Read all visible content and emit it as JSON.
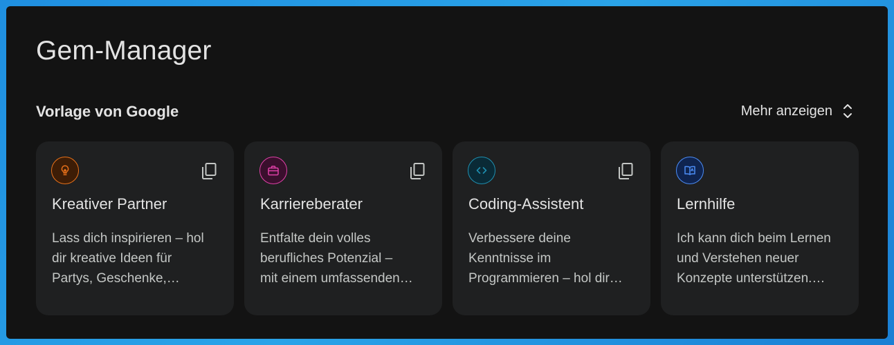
{
  "page": {
    "title": "Gem-Manager"
  },
  "section": {
    "title": "Vorlage von Google",
    "more_label": "Mehr anzeigen"
  },
  "cards": [
    {
      "title": "Kreativer Partner",
      "icon": "lightbulb-icon",
      "accent": "#e8711a",
      "icon_bg": "#3d1d06",
      "desc_lines": [
        "Lass dich inspirieren – hol",
        "dir kreative Ideen für",
        "Partys, Geschenke,…"
      ]
    },
    {
      "title": "Karriereberater",
      "icon": "briefcase-icon",
      "accent": "#e040a8",
      "icon_bg": "#3a0f2d",
      "desc_lines": [
        "Entfalte dein volles",
        "berufliches Potenzial –",
        "mit einem umfassenden…"
      ]
    },
    {
      "title": "Coding-Assistent",
      "icon": "code-icon",
      "accent": "#1e8fb0",
      "icon_bg": "#0a2a36",
      "desc_lines": [
        "Verbessere deine",
        "Kenntnisse im",
        "Programmieren – hol dir…"
      ]
    },
    {
      "title": "Lernhilfe",
      "icon": "book-icon",
      "accent": "#4c8df6",
      "icon_bg": "#0f2450",
      "desc_lines": [
        "Ich kann dich beim Lernen",
        "und Verstehen neuer",
        "Konzepte unterstützen.…"
      ]
    }
  ]
}
